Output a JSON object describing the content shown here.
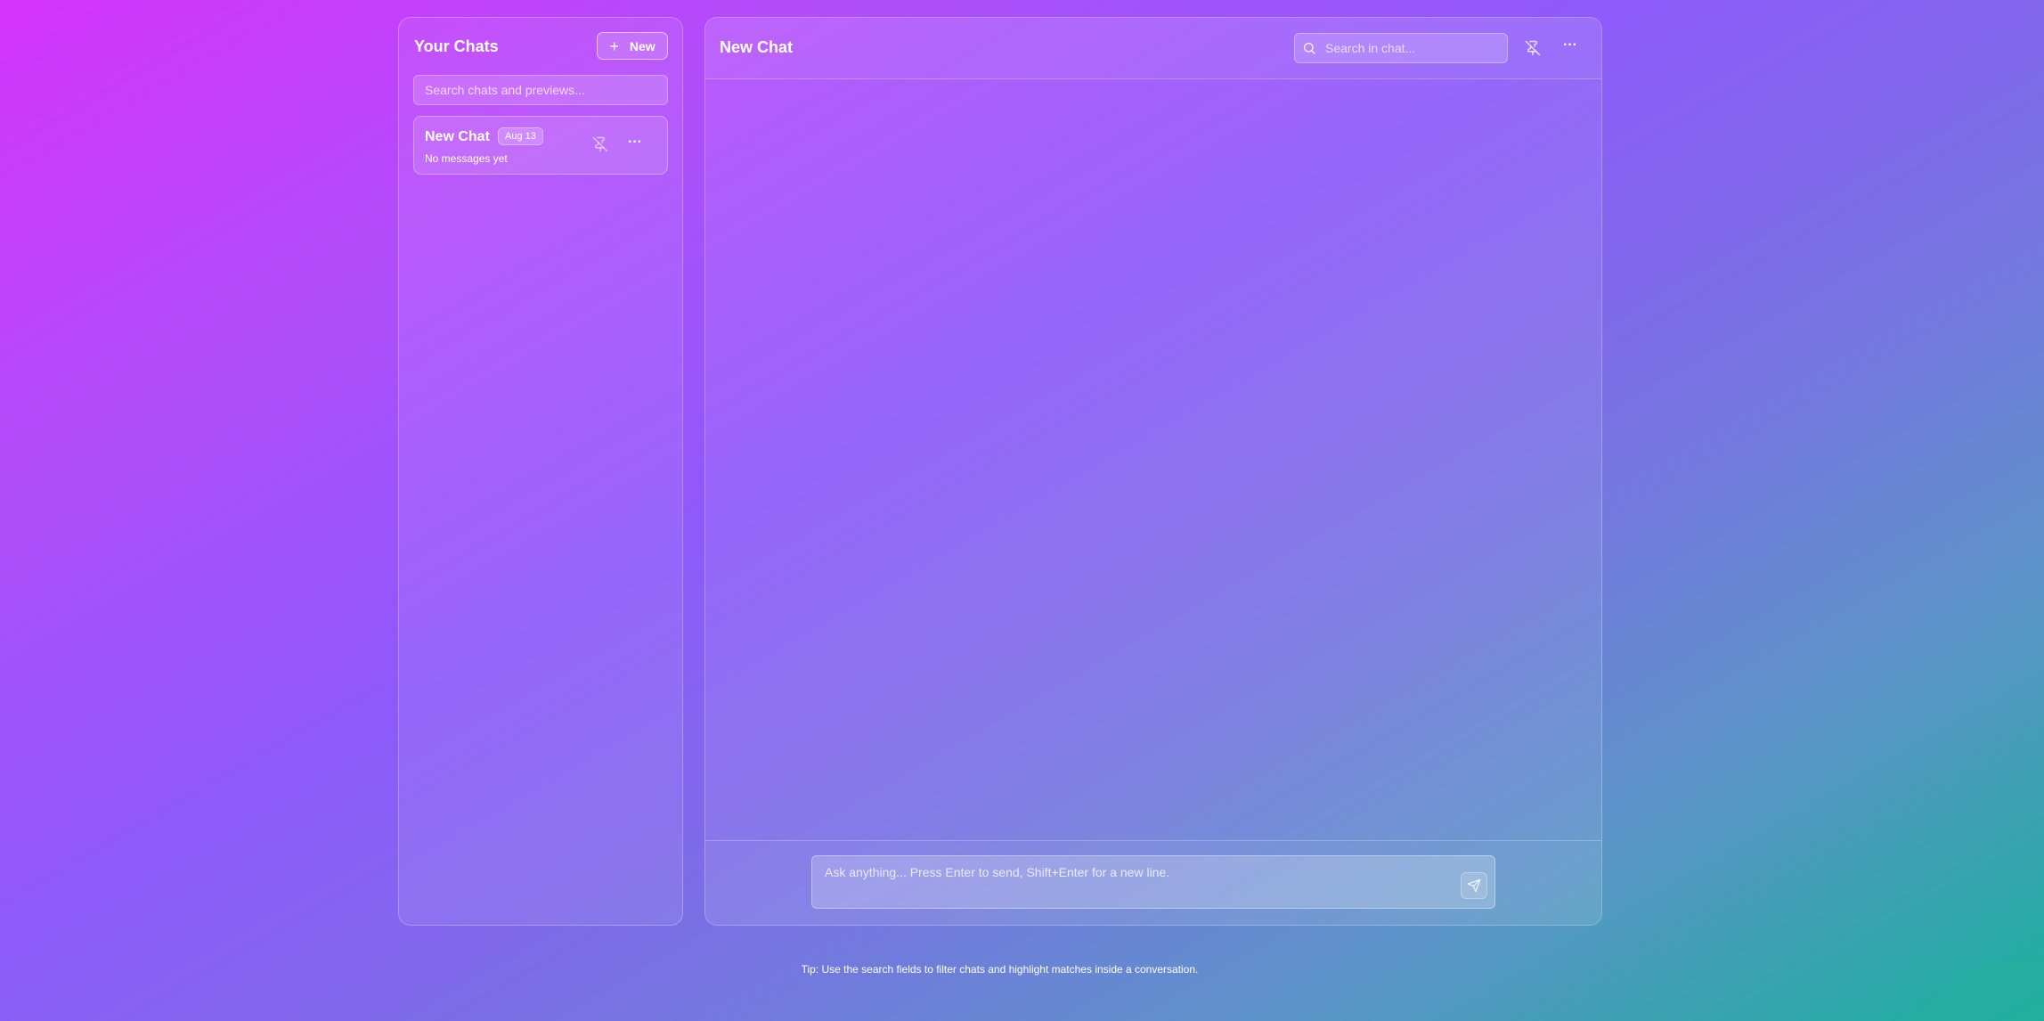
{
  "sidebar": {
    "title": "Your Chats",
    "new_button_label": "New",
    "search_placeholder": "Search chats and previews...",
    "chats": [
      {
        "title": "New Chat",
        "date": "Aug 13",
        "preview": "No messages yet"
      }
    ]
  },
  "main": {
    "title": "New Chat",
    "search_placeholder": "Search in chat...",
    "composer_placeholder": "Ask anything... Press Enter to send, Shift+Enter for a new line."
  },
  "footer": {
    "tip": "Tip: Use the search fields to filter chats and highlight matches inside a conversation."
  },
  "icons": {
    "new": "plus-icon",
    "pin": "pin-off-icon",
    "more": "more-horizontal-icon",
    "search": "search-icon",
    "send": "send-icon"
  }
}
